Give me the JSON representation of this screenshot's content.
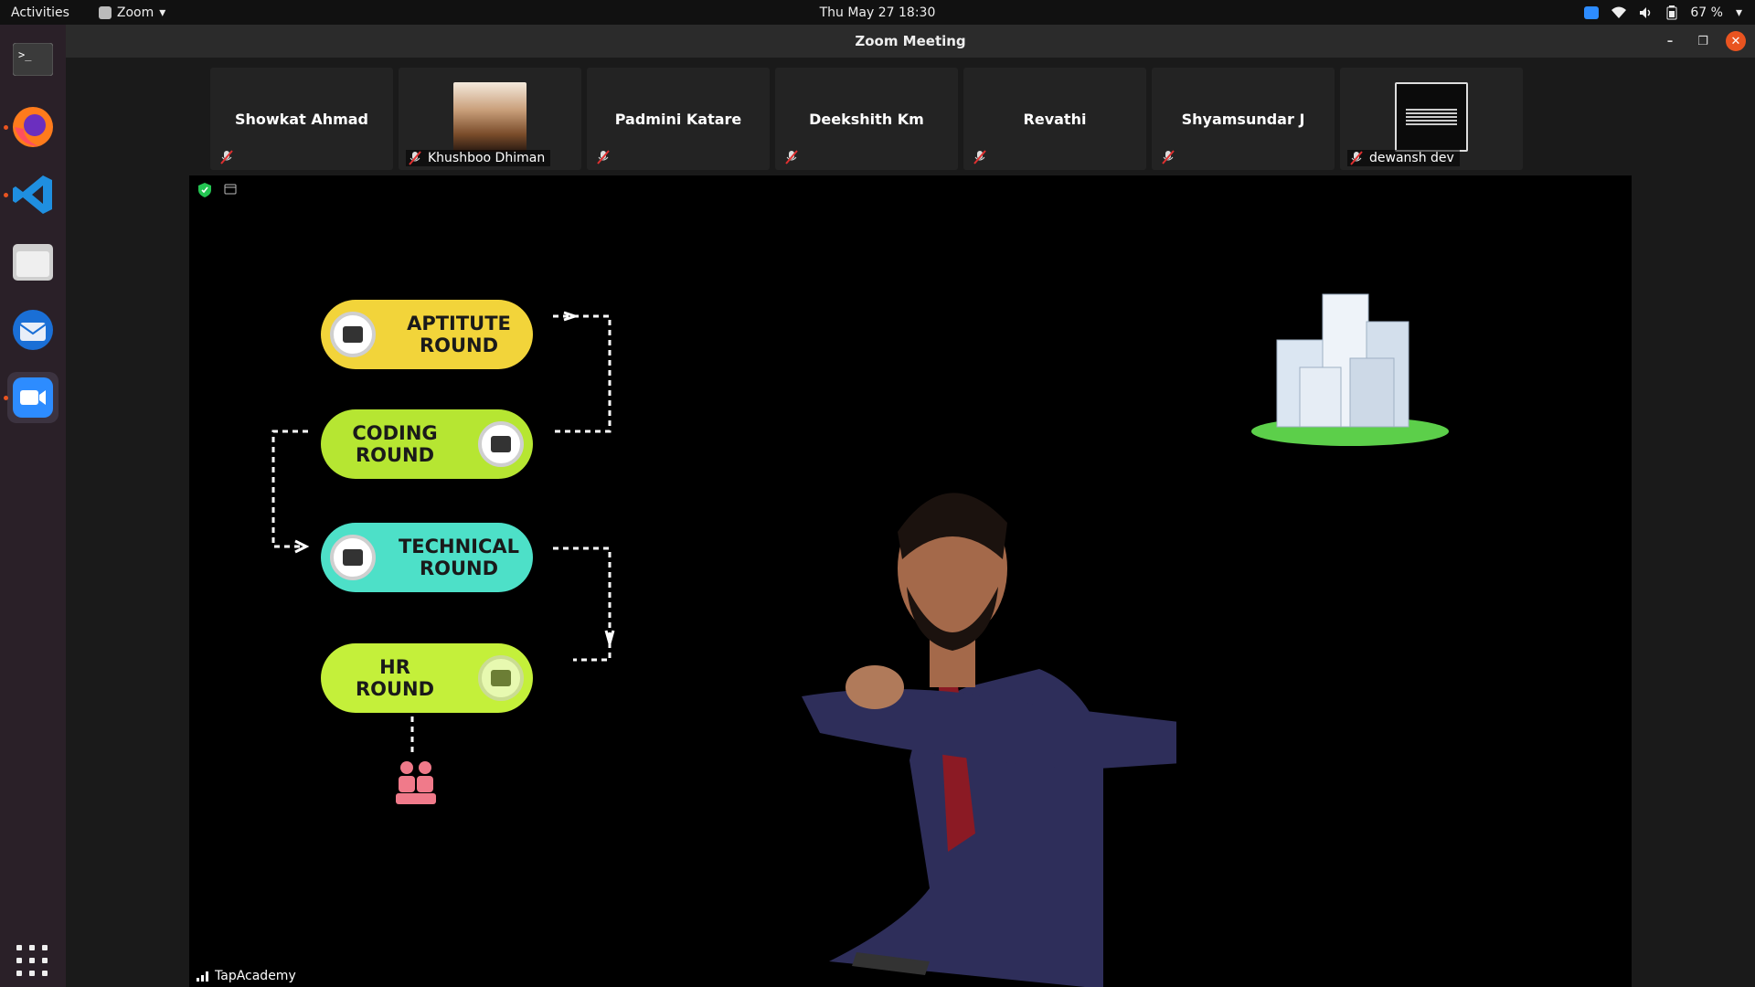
{
  "topbar": {
    "activities": "Activities",
    "app_name": "Zoom",
    "datetime": "Thu May 27  18:30",
    "battery": "67 %"
  },
  "window": {
    "title": "Zoom Meeting"
  },
  "participants": [
    {
      "name": "Showkat Ahmad",
      "muted": true,
      "has_video": false
    },
    {
      "name": "Khushboo Dhiman",
      "muted": true,
      "has_video": true
    },
    {
      "name": "Padmini Katare",
      "muted": true,
      "has_video": false
    },
    {
      "name": "Deekshith Km",
      "muted": true,
      "has_video": false
    },
    {
      "name": "Revathi",
      "muted": true,
      "has_video": false
    },
    {
      "name": "Shyamsundar J",
      "muted": true,
      "has_video": false
    },
    {
      "name": "dewansh dev",
      "muted": true,
      "has_video": true
    }
  ],
  "shared_screen": {
    "presenter_label": "TapAcademy",
    "steps": [
      {
        "line1": "APTITUTE",
        "line2": "ROUND",
        "color": "#f2d43a"
      },
      {
        "line1": "CODING",
        "line2": "ROUND",
        "color": "#b6e632"
      },
      {
        "line1": "TECHNICAL",
        "line2": "ROUND",
        "color": "#4de0c8"
      },
      {
        "line1": "HR",
        "line2": "ROUND",
        "color": "#c4f03a"
      }
    ]
  },
  "dock": {
    "items": [
      "terminal-icon",
      "firefox-icon",
      "vscode-icon",
      "files-icon",
      "thunderbird-icon",
      "zoom-icon"
    ]
  },
  "colors": {
    "accent": "#e95420",
    "zoom_blue": "#2d8cff"
  }
}
